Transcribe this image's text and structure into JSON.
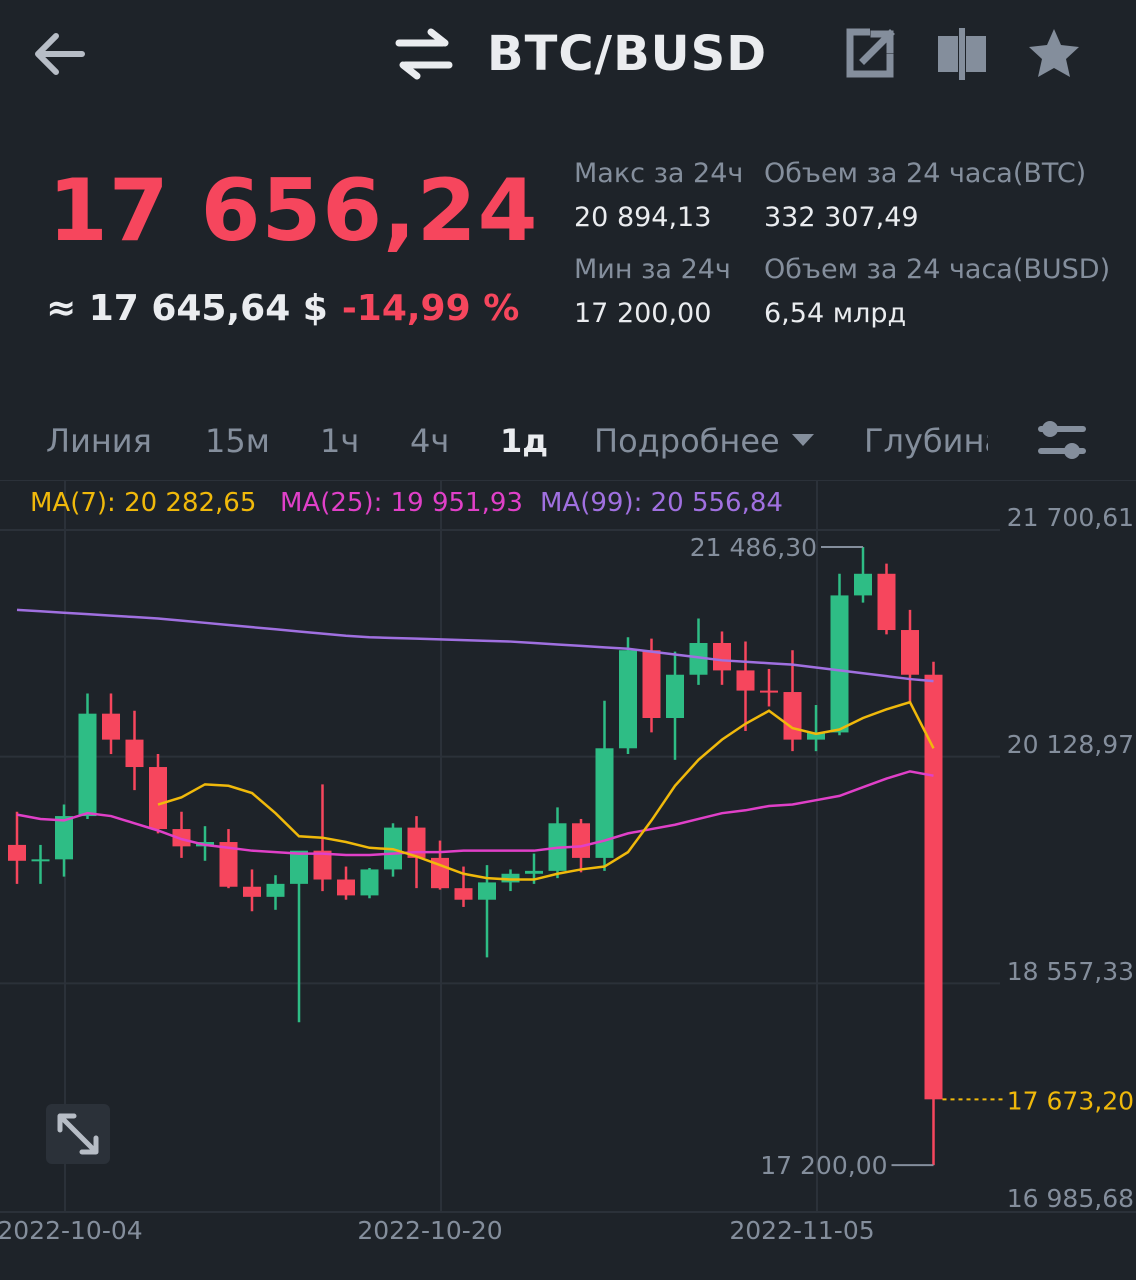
{
  "header": {
    "pair": "BTC/BUSD"
  },
  "ticker": {
    "last_price": "17 656,24",
    "usd_price": "≈ 17 645,64 $",
    "change": "-14,99 %",
    "high_label": "Макс за 24ч",
    "high_value": "20 894,13",
    "low_label": "Мин за 24ч",
    "low_value": "17 200,00",
    "vol_base_label": "Объем за 24 часа(BTC)",
    "vol_base_value": "332 307,49",
    "vol_quote_label": "Объем за 24 часа(BUSD)",
    "vol_quote_value": "6,54 млрд"
  },
  "tabs": [
    {
      "label": "Линия"
    },
    {
      "label": "15м"
    },
    {
      "label": "1ч"
    },
    {
      "label": "4ч"
    },
    {
      "label": "1д",
      "active": true
    },
    {
      "label": "Подробнее"
    },
    {
      "label": "Глубина"
    }
  ],
  "indicators": {
    "ma7": "MA(7): 20 282,65",
    "ma25": "MA(25): 19 951,93",
    "ma99": "MA(99): 20 556,84"
  },
  "colors": {
    "up": "#2ebd85",
    "down": "#f6465d",
    "ma7": "#f0b90b",
    "ma25": "#e040c8",
    "ma99": "#a070e0",
    "price_line": "#f0b90b"
  },
  "chart_data": {
    "type": "candlestick",
    "interval": "1д",
    "y_axis_labels": [
      "21 700,61",
      "20 128,97",
      "18 557,33",
      "16 985,68"
    ],
    "x_axis_labels": [
      "2022-10-04",
      "2022-10-20",
      "2022-11-05"
    ],
    "high_marker": "21 486,30",
    "low_marker": "17 200,00",
    "current_price_label": "17 673,20",
    "candles": [
      {
        "date": "2022-09-30",
        "o": 19420,
        "h": 19650,
        "l": 19150,
        "c": 19310
      },
      {
        "date": "2022-10-01",
        "o": 19310,
        "h": 19420,
        "l": 19150,
        "c": 19320
      },
      {
        "date": "2022-10-02",
        "o": 19320,
        "h": 19700,
        "l": 19200,
        "c": 19620
      },
      {
        "date": "2022-10-03",
        "o": 19620,
        "h": 20470,
        "l": 19600,
        "c": 20330
      },
      {
        "date": "2022-10-04",
        "o": 20330,
        "h": 20470,
        "l": 20050,
        "c": 20150
      },
      {
        "date": "2022-10-05",
        "o": 20150,
        "h": 20350,
        "l": 19800,
        "c": 19960
      },
      {
        "date": "2022-10-06",
        "o": 19960,
        "h": 20050,
        "l": 19500,
        "c": 19530
      },
      {
        "date": "2022-10-07",
        "o": 19530,
        "h": 19650,
        "l": 19330,
        "c": 19410
      },
      {
        "date": "2022-10-08",
        "o": 19410,
        "h": 19550,
        "l": 19310,
        "c": 19440
      },
      {
        "date": "2022-10-09",
        "o": 19440,
        "h": 19530,
        "l": 19120,
        "c": 19130
      },
      {
        "date": "2022-10-10",
        "o": 19130,
        "h": 19250,
        "l": 18960,
        "c": 19060
      },
      {
        "date": "2022-10-11",
        "o": 19060,
        "h": 19210,
        "l": 18970,
        "c": 19150
      },
      {
        "date": "2022-10-12",
        "o": 19150,
        "h": 19340,
        "l": 18190,
        "c": 19380
      },
      {
        "date": "2022-10-13",
        "o": 19380,
        "h": 19840,
        "l": 19100,
        "c": 19180
      },
      {
        "date": "2022-10-14",
        "o": 19180,
        "h": 19270,
        "l": 19040,
        "c": 19070
      },
      {
        "date": "2022-10-15",
        "o": 19070,
        "h": 19260,
        "l": 19050,
        "c": 19250
      },
      {
        "date": "2022-10-16",
        "o": 19250,
        "h": 19570,
        "l": 19200,
        "c": 19540
      },
      {
        "date": "2022-10-17",
        "o": 19540,
        "h": 19620,
        "l": 19120,
        "c": 19330
      },
      {
        "date": "2022-10-18",
        "o": 19330,
        "h": 19450,
        "l": 19110,
        "c": 19120
      },
      {
        "date": "2022-10-19",
        "o": 19120,
        "h": 19270,
        "l": 18990,
        "c": 19040
      },
      {
        "date": "2022-10-20",
        "o": 19040,
        "h": 19280,
        "l": 18640,
        "c": 19160
      },
      {
        "date": "2022-10-21",
        "o": 19160,
        "h": 19250,
        "l": 19100,
        "c": 19220
      },
      {
        "date": "2022-10-22",
        "o": 19220,
        "h": 19360,
        "l": 19150,
        "c": 19240
      },
      {
        "date": "2022-10-23",
        "o": 19240,
        "h": 19680,
        "l": 19190,
        "c": 19570
      },
      {
        "date": "2022-10-24",
        "o": 19570,
        "h": 19600,
        "l": 19230,
        "c": 19330
      },
      {
        "date": "2022-10-25",
        "o": 19330,
        "h": 20420,
        "l": 19240,
        "c": 20090
      },
      {
        "date": "2022-10-26",
        "o": 20090,
        "h": 20860,
        "l": 20050,
        "c": 20770
      },
      {
        "date": "2022-10-27",
        "o": 20770,
        "h": 20850,
        "l": 20200,
        "c": 20300
      },
      {
        "date": "2022-10-28",
        "o": 20300,
        "h": 20760,
        "l": 20010,
        "c": 20600
      },
      {
        "date": "2022-10-29",
        "o": 20600,
        "h": 20990,
        "l": 20530,
        "c": 20820
      },
      {
        "date": "2022-10-30",
        "o": 20820,
        "h": 20900,
        "l": 20530,
        "c": 20630
      },
      {
        "date": "2022-10-31",
        "o": 20630,
        "h": 20830,
        "l": 20210,
        "c": 20490
      },
      {
        "date": "2022-11-01",
        "o": 20490,
        "h": 20640,
        "l": 20380,
        "c": 20480
      },
      {
        "date": "2022-11-02",
        "o": 20480,
        "h": 20770,
        "l": 20070,
        "c": 20150
      },
      {
        "date": "2022-11-03",
        "o": 20150,
        "h": 20390,
        "l": 20070,
        "c": 20200
      },
      {
        "date": "2022-11-04",
        "o": 20200,
        "h": 21300,
        "l": 20180,
        "c": 21150
      },
      {
        "date": "2022-11-05",
        "o": 21150,
        "h": 21486,
        "l": 21100,
        "c": 21300
      },
      {
        "date": "2022-11-06",
        "o": 21300,
        "h": 21370,
        "l": 20880,
        "c": 20910
      },
      {
        "date": "2022-11-07",
        "o": 20910,
        "h": 21050,
        "l": 20410,
        "c": 20600
      },
      {
        "date": "2022-11-08",
        "o": 20600,
        "h": 20690,
        "l": 17200,
        "c": 17656
      }
    ],
    "ma7": [
      null,
      null,
      null,
      null,
      null,
      null,
      19700,
      19750,
      19840,
      19830,
      19780,
      19640,
      19480,
      19470,
      19440,
      19400,
      19390,
      19340,
      19280,
      19220,
      19190,
      19180,
      19180,
      19220,
      19250,
      19270,
      19370,
      19590,
      19830,
      20010,
      20150,
      20260,
      20350,
      20230,
      20190,
      20220,
      20300,
      20360,
      20410,
      20090
    ],
    "ma25": [
      19630,
      19600,
      19590,
      19640,
      19620,
      19570,
      19520,
      19460,
      19420,
      19400,
      19380,
      19370,
      19360,
      19360,
      19350,
      19350,
      19360,
      19370,
      19370,
      19380,
      19380,
      19380,
      19380,
      19400,
      19410,
      19450,
      19500,
      19530,
      19560,
      19600,
      19640,
      19660,
      19690,
      19700,
      19730,
      19760,
      19820,
      19880,
      19930,
      19900
    ],
    "ma99": [
      21050,
      21040,
      21030,
      21020,
      21010,
      21000,
      20990,
      20975,
      20960,
      20945,
      20930,
      20915,
      20900,
      20885,
      20870,
      20860,
      20855,
      20850,
      20845,
      20840,
      20835,
      20830,
      20820,
      20810,
      20800,
      20790,
      20780,
      20760,
      20740,
      20720,
      20700,
      20690,
      20680,
      20670,
      20650,
      20630,
      20610,
      20590,
      20570,
      20556
    ]
  }
}
